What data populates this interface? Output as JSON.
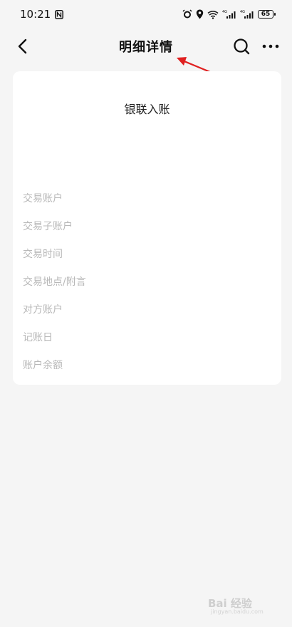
{
  "status_bar": {
    "time": "10:21",
    "battery": "65"
  },
  "header": {
    "title": "明细详情"
  },
  "card": {
    "title": "银联入账",
    "fields": [
      {
        "label": "交易账户"
      },
      {
        "label": "交易子账户"
      },
      {
        "label": "交易时间"
      },
      {
        "label": "交易地点/附言"
      },
      {
        "label": "对方账户"
      },
      {
        "label": "记账日"
      },
      {
        "label": "账户余额"
      }
    ]
  },
  "annotation": {
    "arrow_color": "#e02020"
  },
  "watermark": {
    "text": "Bai 经验",
    "url": "jingyan.baidu.com"
  }
}
